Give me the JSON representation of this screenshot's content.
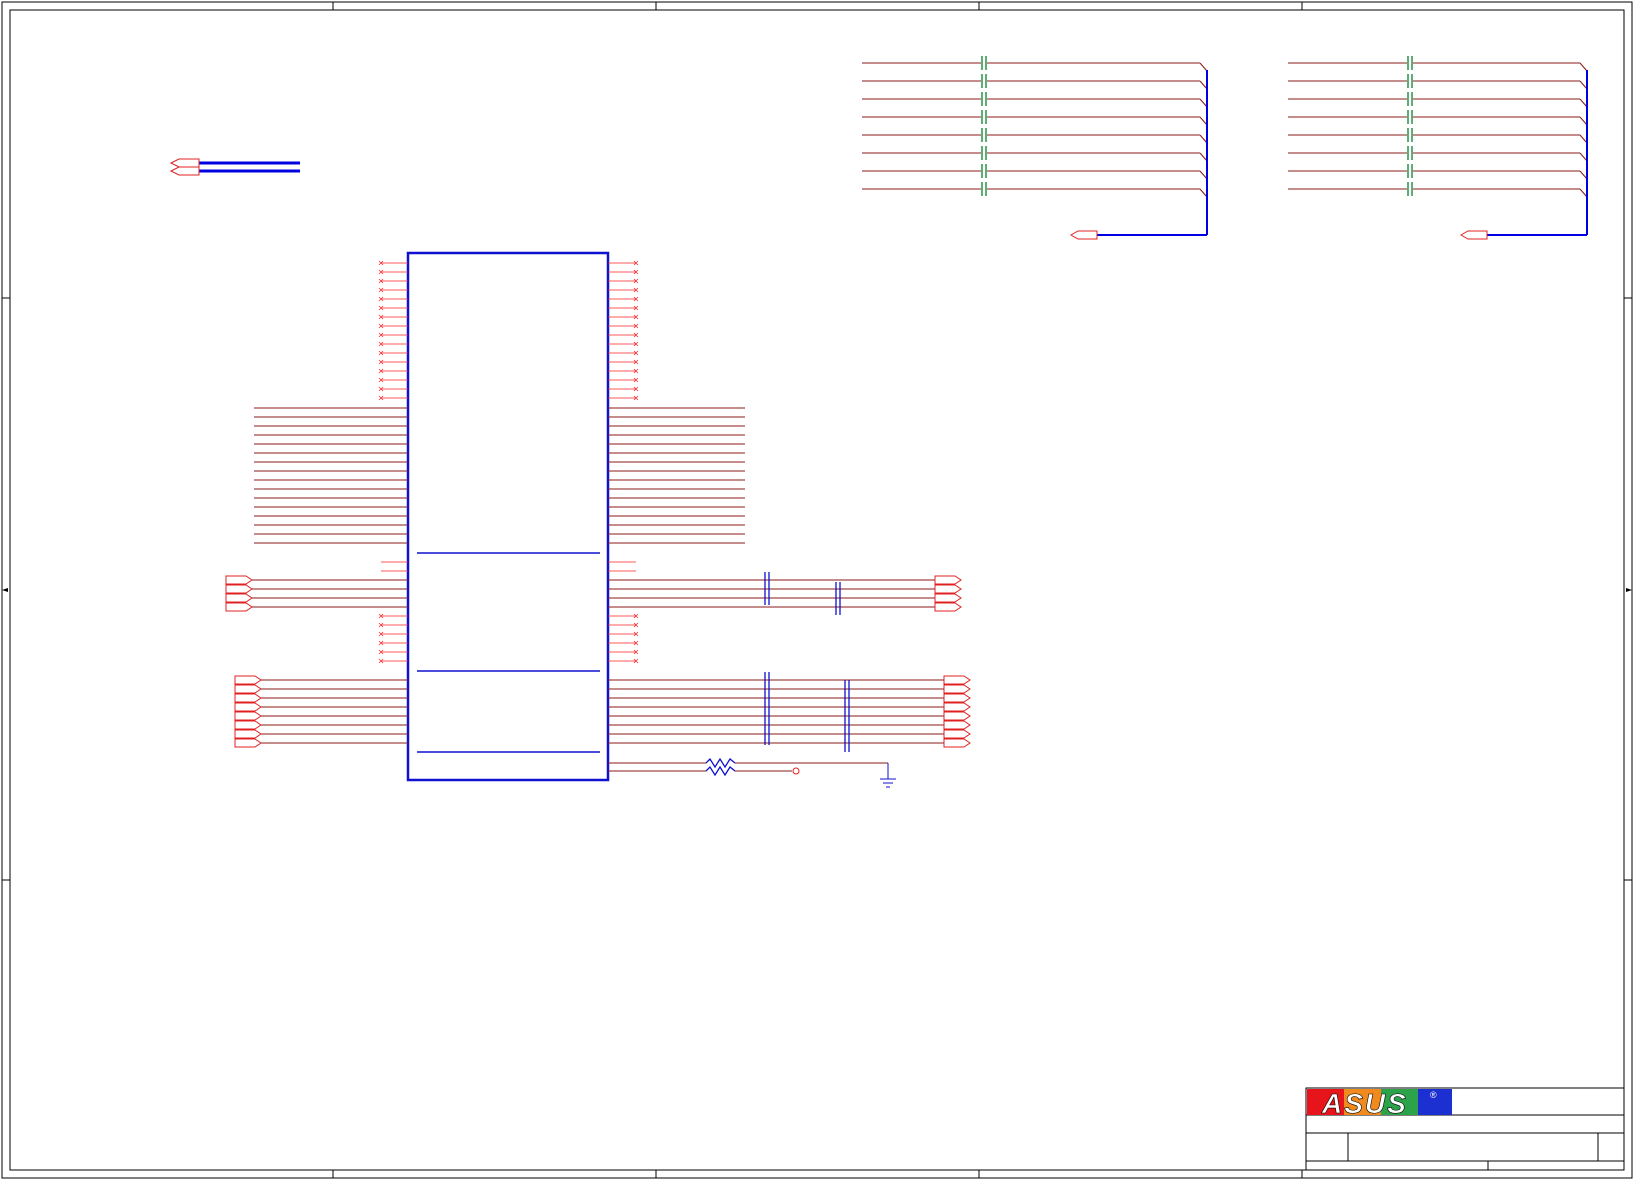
{
  "sheet": {
    "logo": {
      "text": "ASUS",
      "registered_mark": "®",
      "colors": {
        "red": "#e8141c",
        "orange": "#f08a1d",
        "green": "#2ca24b",
        "blue": "#1c2fd0"
      }
    }
  },
  "colors": {
    "frame": "#000000",
    "wire": "#8b1a1a",
    "bus": "#0000e0",
    "pin": "#ff2020",
    "component": "#1010d0",
    "connector": "#e02020",
    "green_cap": "#1a8a3a"
  }
}
